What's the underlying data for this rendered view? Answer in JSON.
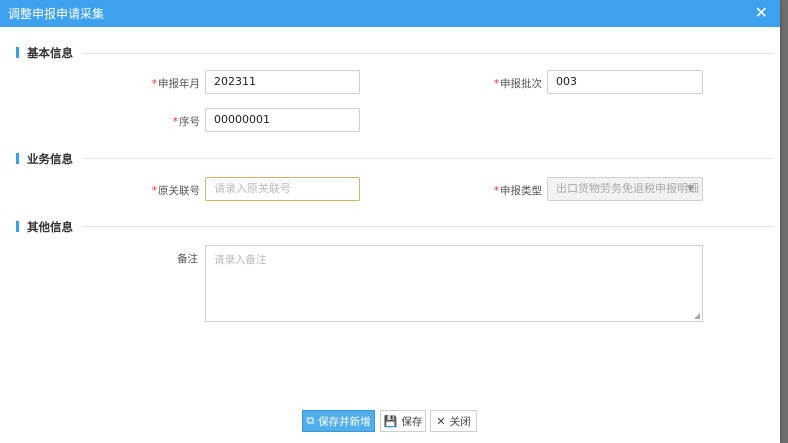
{
  "dialog": {
    "title": "调整申报申请采集",
    "close_icon": "✕"
  },
  "sections": {
    "basic": "基本信息",
    "business": "业务信息",
    "other": "其他信息"
  },
  "fields": {
    "declare_month": {
      "label": "申报年月",
      "value": "202311"
    },
    "declare_batch": {
      "label": "申报批次",
      "value": "003"
    },
    "serial_no": {
      "label": "序号",
      "value": "00000001"
    },
    "original_ref": {
      "label": "原关联号",
      "placeholder": "请录入原关联号"
    },
    "declare_type": {
      "label": "申报类型",
      "value": "出口货物劳务免退税申报明细"
    },
    "remark": {
      "label": "备注",
      "placeholder": "请录入备注"
    }
  },
  "buttons": {
    "save_add": "保存并新增",
    "save": "保存",
    "close": "关闭"
  },
  "colors": {
    "title_bar": "#3ea1f0",
    "accent": "#3aa0e6",
    "primary_button": "#52aeea"
  }
}
